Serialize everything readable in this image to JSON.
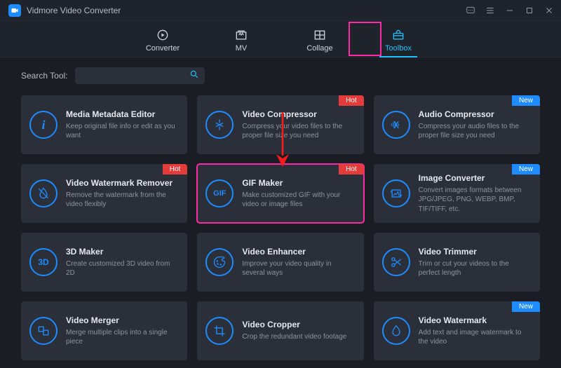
{
  "app": {
    "title": "Vidmore Video Converter"
  },
  "tabs": [
    {
      "label": "Converter"
    },
    {
      "label": "MV"
    },
    {
      "label": "Collage"
    },
    {
      "label": "Toolbox"
    }
  ],
  "search": {
    "label": "Search Tool:",
    "placeholder": ""
  },
  "badges": {
    "hot": "Hot",
    "new": "New"
  },
  "tools": [
    {
      "title": "Media Metadata Editor",
      "desc": "Keep original file info or edit as you want",
      "icon": "info",
      "badge": null
    },
    {
      "title": "Video Compressor",
      "desc": "Compress your video files to the proper file size you need",
      "icon": "compress-v",
      "badge": "hot"
    },
    {
      "title": "Audio Compressor",
      "desc": "Compress your audio files to the proper file size you need",
      "icon": "compress-a",
      "badge": "new"
    },
    {
      "title": "Video Watermark Remover",
      "desc": "Remove the watermark from the video flexibly",
      "icon": "droplet-x",
      "badge": "hot"
    },
    {
      "title": "GIF Maker",
      "desc": "Make customized GIF with your video or image files",
      "icon": "gif",
      "badge": "hot"
    },
    {
      "title": "Image Converter",
      "desc": "Convert images formats between JPG/JPEG, PNG, WEBP, BMP, TIF/TIFF, etc.",
      "icon": "image",
      "badge": "new"
    },
    {
      "title": "3D Maker",
      "desc": "Create customized 3D video from 2D",
      "icon": "3d",
      "badge": null
    },
    {
      "title": "Video Enhancer",
      "desc": "Improve your video quality in several ways",
      "icon": "palette",
      "badge": null
    },
    {
      "title": "Video Trimmer",
      "desc": "Trim or cut your videos to the perfect length",
      "icon": "scissors",
      "badge": null
    },
    {
      "title": "Video Merger",
      "desc": "Merge multiple clips into a single piece",
      "icon": "merge",
      "badge": null
    },
    {
      "title": "Video Cropper",
      "desc": "Crop the redundant video footage",
      "icon": "crop",
      "badge": null
    },
    {
      "title": "Video Watermark",
      "desc": "Add text and image watermark to the video",
      "icon": "droplet",
      "badge": "new"
    }
  ],
  "annotation": {
    "highlight_tab_index": 3,
    "highlight_card_index": 4,
    "arrow": true
  },
  "colors": {
    "accent": "#1e8cff",
    "cyan": "#1ec2ff",
    "magenta": "#ff2aa8",
    "hot": "#e43b3b"
  }
}
